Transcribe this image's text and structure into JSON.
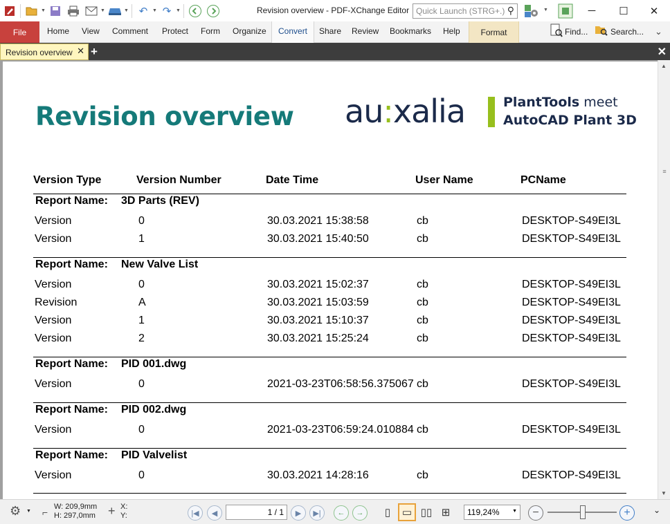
{
  "window": {
    "title": "Revision overview - PDF-XChange Editor",
    "quick_launch_placeholder": "Quick Launch (STRG+.)",
    "controls": {
      "minimize": "─",
      "maximize": "☐",
      "close": "✕"
    }
  },
  "ribbon": {
    "file_label": "File",
    "tabs": [
      "Home",
      "View",
      "Comment",
      "Protect",
      "Form",
      "Organize",
      "Convert",
      "Share",
      "Review",
      "Bookmarks",
      "Help"
    ],
    "active_tab": "Convert",
    "context_tab": "Format",
    "find_label": "Find...",
    "search_label": "Search..."
  },
  "doc_tab": {
    "label": "Revision overview",
    "close": "✕",
    "new_tab": "+",
    "close_all": "✕"
  },
  "document": {
    "title": "Revision overview",
    "logo": {
      "brand_left": "au",
      "brand_colon": ":",
      "brand_right": "xalia",
      "tagline_bold": "PlantTools",
      "tagline_light": " meet",
      "tagline_line2": "AutoCAD Plant 3D"
    },
    "columns": [
      "Version Type",
      "Version Number",
      "Date Time",
      "User Name",
      "PCName"
    ],
    "report_label": "Report Name:",
    "groups": [
      {
        "report": "3D Parts (REV)",
        "rows": [
          {
            "type": "Version",
            "number": "0",
            "datetime": "30.03.2021 15:38:58",
            "user": "cb",
            "pc": "DESKTOP-S49EI3L"
          },
          {
            "type": "Version",
            "number": "1",
            "datetime": "30.03.2021 15:40:50",
            "user": "cb",
            "pc": "DESKTOP-S49EI3L"
          }
        ]
      },
      {
        "report": "New Valve List",
        "rows": [
          {
            "type": "Version",
            "number": "0",
            "datetime": "30.03.2021 15:02:37",
            "user": "cb",
            "pc": "DESKTOP-S49EI3L"
          },
          {
            "type": "Revision",
            "number": "A",
            "datetime": "30.03.2021 15:03:59",
            "user": "cb",
            "pc": "DESKTOP-S49EI3L"
          },
          {
            "type": "Version",
            "number": "1",
            "datetime": "30.03.2021 15:10:37",
            "user": "cb",
            "pc": "DESKTOP-S49EI3L"
          },
          {
            "type": "Version",
            "number": "2",
            "datetime": "30.03.2021 15:25:24",
            "user": "cb",
            "pc": "DESKTOP-S49EI3L"
          }
        ]
      },
      {
        "report": "PID 001.dwg",
        "rows": [
          {
            "type": "Version",
            "number": "0",
            "datetime": "2021-03-23T06:58:56.375067",
            "user": "cb",
            "pc": "DESKTOP-S49EI3L"
          }
        ]
      },
      {
        "report": "PID 002.dwg",
        "rows": [
          {
            "type": "Version",
            "number": "0",
            "datetime": "2021-03-23T06:59:24.010884",
            "user": "cb",
            "pc": "DESKTOP-S49EI3L"
          }
        ]
      },
      {
        "report": "PID Valvelist",
        "rows": [
          {
            "type": "Version",
            "number": "0",
            "datetime": "30.03.2021 14:28:16",
            "user": "cb",
            "pc": "DESKTOP-S49EI3L"
          }
        ]
      }
    ]
  },
  "status": {
    "width_text": "W: 209,9mm",
    "height_text": "H: 297,0mm",
    "x_label": "X:",
    "y_label": "Y:",
    "page_display": "1 / 1",
    "zoom": "119,24%"
  },
  "colors": {
    "title_teal": "#157a79",
    "brand_navy": "#1b2a4a",
    "brand_green": "#97bf1d",
    "file_tab": "#c8413d",
    "doc_tab": "#fff6bf"
  }
}
